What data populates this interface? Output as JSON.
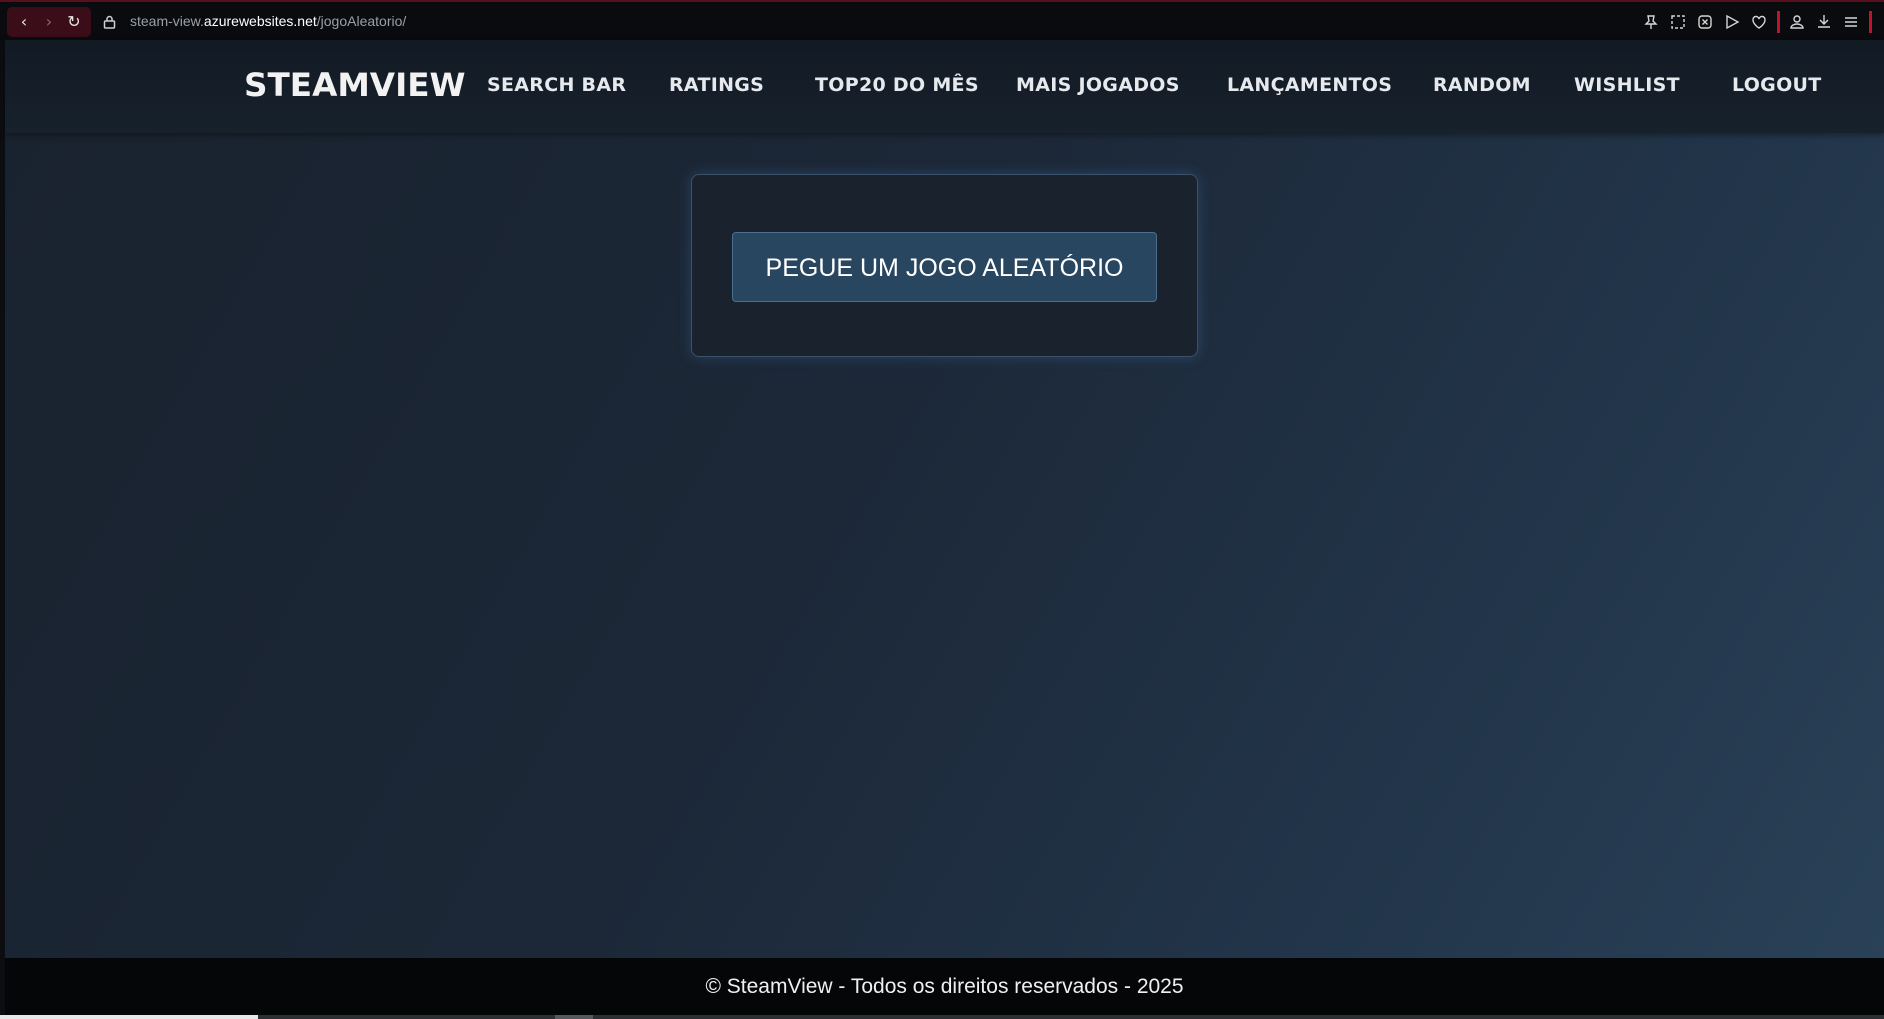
{
  "browser": {
    "url_prefix": "steam-view.",
    "url_domain": "azurewebsites.net",
    "url_path": "/jogoAleatorio/",
    "back_glyph": "‹",
    "forward_glyph": "›",
    "reload_glyph": "↻",
    "icons": [
      "pin-icon",
      "screenshot-icon",
      "block-icon",
      "send-icon",
      "heart-icon",
      "profile-icon",
      "download-icon",
      "menu-icon"
    ]
  },
  "header": {
    "logo": "STEAMVIEW",
    "nav": {
      "search_bar": "SEARCH BAR",
      "ratings": "RATINGS",
      "top20": "TOP20 DO MÊS",
      "mais_jogados": "MAIS JOGADOS",
      "lancamentos": "LANÇAMENTOS",
      "random": "RANDOM",
      "wishlist": "WISHLIST",
      "logout": "LOGOUT"
    }
  },
  "main": {
    "random_button": "PEGUE UM JOGO ALEATÓRIO"
  },
  "footer": {
    "text": "© SteamView - Todos os direitos reservados - 2025"
  },
  "colors": {
    "accent": "#294660",
    "header_bg": "#121a24",
    "footer_bg": "#050607",
    "browser_accent": "#c0142c"
  }
}
